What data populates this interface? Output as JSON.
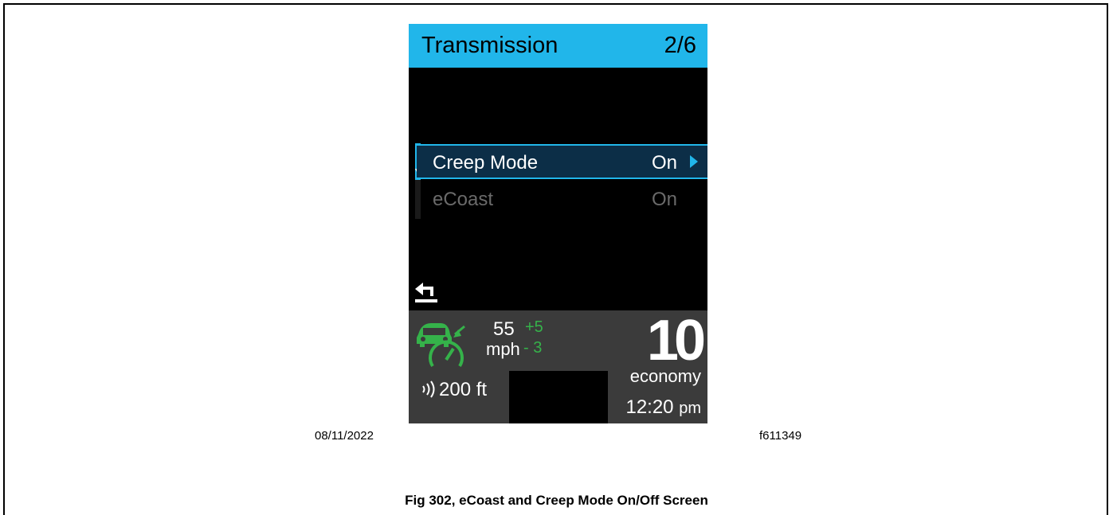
{
  "screen": {
    "title": "Transmission",
    "page": "2/6",
    "menu_items": [
      {
        "label": "Creep Mode",
        "value": "On",
        "selected": true
      },
      {
        "label": "eCoast",
        "value": "On",
        "selected": false
      }
    ],
    "icons": {
      "back": "back-arrow-icon",
      "cruise": "adaptive-cruise-icon",
      "distance": "distance-signal-icon",
      "submenu": "chevron-right-icon",
      "scroll": "scroll-down-indicator"
    }
  },
  "status_bar": {
    "set_speed": "55",
    "speed_unit": "mph",
    "delta_up": "+5",
    "delta_down": "- 3",
    "gear": "10",
    "gear_mode": "economy",
    "following_distance": "200 ft",
    "time": "12:20",
    "time_suffix": "pm"
  },
  "figure": {
    "date": "08/11/2022",
    "id": "f611349",
    "caption": "Fig 302, eCoast and Creep Mode On/Off Screen"
  },
  "colors": {
    "header": "#21b6ea",
    "cruise_green": "#35b24a",
    "selected_row": "#0c2e47"
  }
}
